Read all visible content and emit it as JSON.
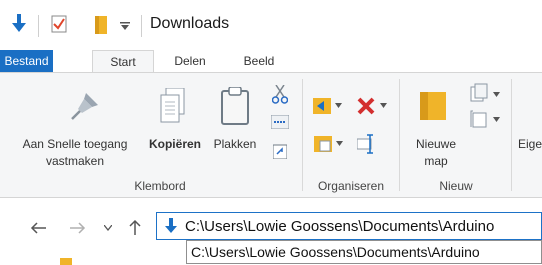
{
  "window": {
    "title": "Downloads"
  },
  "quick_access": {
    "icons": [
      "download-arrow-icon",
      "properties-check-icon",
      "new-folder-icon",
      "customize-dropdown-icon"
    ]
  },
  "tabs": [
    {
      "label": "Bestand",
      "state": "file"
    },
    {
      "label": "Start",
      "state": "active"
    },
    {
      "label": "Delen",
      "state": "normal"
    },
    {
      "label": "Beeld",
      "state": "normal"
    }
  ],
  "ribbon": {
    "pin_label_line1": "Aan Snelle toegang",
    "pin_label_line2": "vastmaken",
    "copy_label": "Kopiëren",
    "paste_label": "Plakken",
    "new_folder_line1": "Nieuwe",
    "new_folder_line2": "map",
    "properties_partial": "Eige",
    "groups": {
      "clipboard": "Klembord",
      "organize": "Organiseren",
      "new": "Nieuw"
    }
  },
  "address": {
    "value": "C:\\Users\\Lowie Goossens\\Documents\\Arduino",
    "suggestion": "C:\\Users\\Lowie Goossens\\Documents\\Arduino"
  },
  "colors": {
    "accent": "#1a6fc4",
    "folder": "#f0b429",
    "delete": "#d32f2f"
  }
}
